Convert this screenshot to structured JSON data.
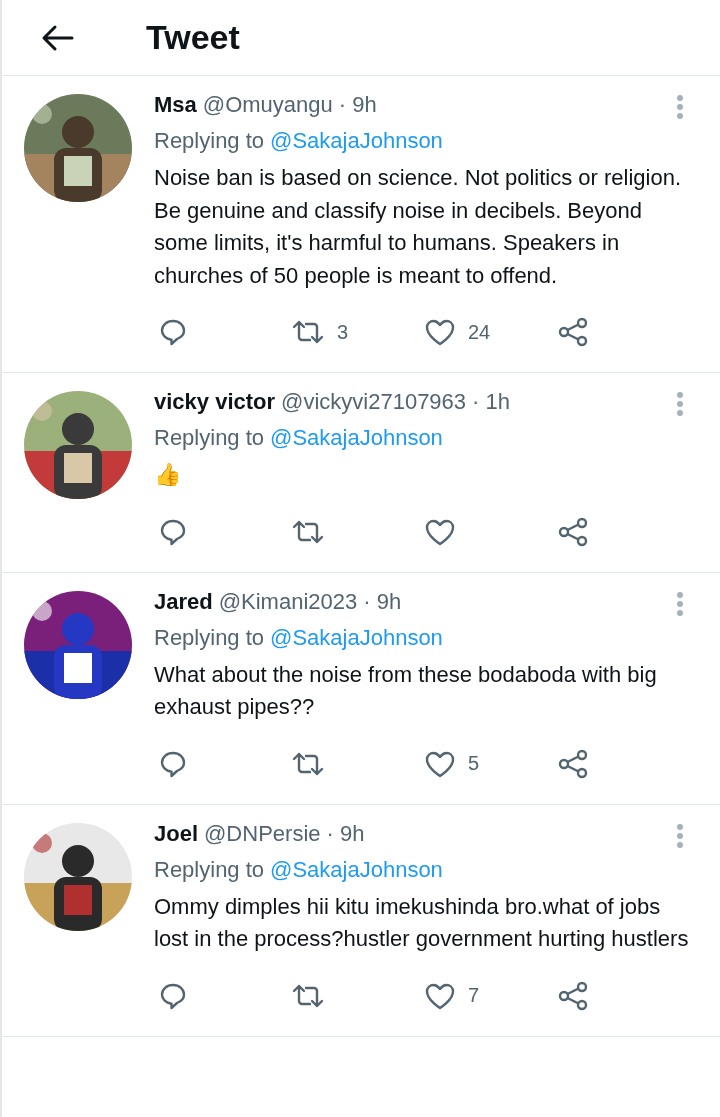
{
  "header": {
    "title": "Tweet"
  },
  "tweets": [
    {
      "name": "Msa",
      "handle": "@Omuyangu",
      "time": "· 9h",
      "replying_prefix": "Replying to",
      "replying_to": "@SakajaJohnson",
      "text": "Noise ban is based on science. Not politics or religion. Be genuine and classify noise in decibels. Beyond some limits, it's harmful to humans. Speakers in churches of 50 people is meant to offend.",
      "retweets": "3",
      "likes": "24"
    },
    {
      "name": "vicky victor",
      "handle": "@vickyvi27107963",
      "time": "· 1h",
      "replying_prefix": "Replying to",
      "replying_to": "@SakajaJohnson",
      "text": "👍"
    },
    {
      "name": "Jared",
      "handle": "@Kimani2023",
      "time": "· 9h",
      "replying_prefix": "Replying to",
      "replying_to": "@SakajaJohnson",
      "text": "What about the noise from these bodaboda with big exhaust pipes??",
      "likes": "5"
    },
    {
      "name": "Joel",
      "handle": "@DNPersie",
      "time": "· 9h",
      "replying_prefix": "Replying to",
      "replying_to": "@SakajaJohnson",
      "text": "Ommy dimples hii kitu imekushinda bro.what of jobs lost in the process?hustler government hurting hustlers",
      "likes": "7"
    }
  ]
}
